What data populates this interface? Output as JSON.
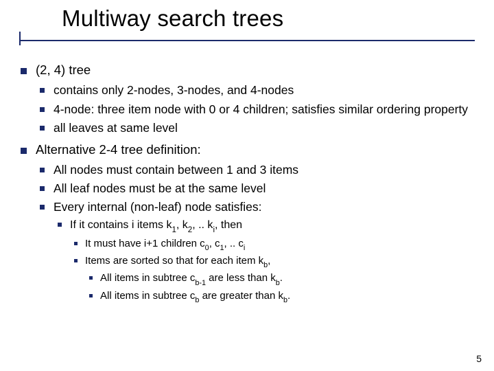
{
  "title": "Multiway search trees",
  "sections": [
    {
      "heading": "(2, 4) tree",
      "items": [
        {
          "text": "contains only 2-nodes, 3-nodes, and 4-nodes"
        },
        {
          "text": "4-node: three item node with 0 or 4 children; satisfies similar ordering property"
        },
        {
          "text": "all leaves at same level"
        }
      ]
    },
    {
      "heading": "Alternative 2-4 tree definition:",
      "items": [
        {
          "text": "All nodes must contain between 1 and 3 items"
        },
        {
          "text": "All leaf nodes must be at the same level"
        },
        {
          "text": "Every internal (non-leaf) node satisfies:",
          "children": [
            {
              "html": "If it contains i items k<span class=\"sub\">1</span>, k<span class=\"sub\">2</span>, .. k<span class=\"sub\">i</span>, then",
              "children": [
                {
                  "html": "It must have i+1 children c<span class=\"sub\">0</span>, c<span class=\"sub\">1</span>, .. c<span class=\"sub\">i</span>"
                },
                {
                  "html": "Items are sorted so that for each item k<span class=\"sub\">b</span>,",
                  "children": [
                    {
                      "html": "All items in subtree c<span class=\"sub\">b-1</span> are less than k<span class=\"sub\">b</span>."
                    },
                    {
                      "html": "All items in subtree c<span class=\"sub\">b</span> are greater than k<span class=\"sub\">b</span>."
                    }
                  ]
                }
              ]
            }
          ]
        }
      ]
    }
  ],
  "page_number": "5"
}
